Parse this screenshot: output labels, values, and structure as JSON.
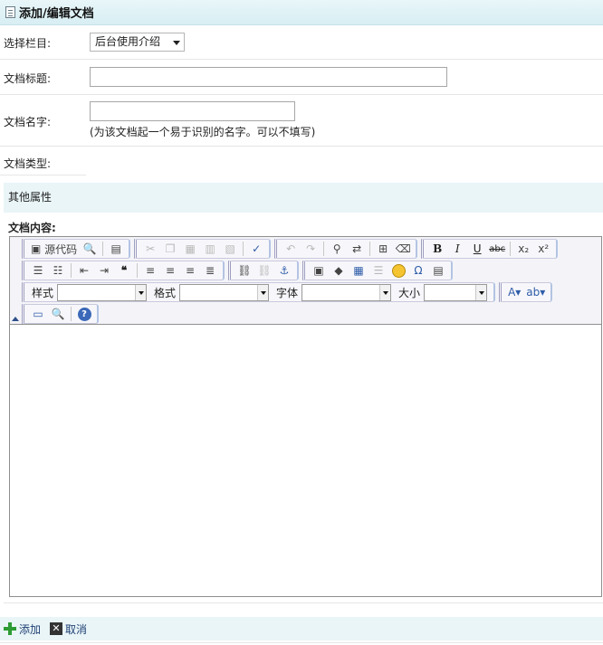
{
  "header": {
    "title": "添加/编辑文档",
    "icon": "document-edit-icon"
  },
  "form": {
    "section_label": "选择栏目:",
    "section_value": "后台使用介绍",
    "title_label": "文档标题:",
    "title_value": "",
    "name_label": "文档名字:",
    "name_value": "",
    "name_hint": "(为该文档起一个易于识别的名字。可以不填写)",
    "type_label": "文档类型:",
    "type_value": ""
  },
  "other_attributes": "其他属性",
  "content_label": "文档内容:",
  "editor": {
    "source_label": "源代码",
    "style_label": "样式",
    "format_label": "格式",
    "font_label": "字体",
    "size_label": "大小",
    "style_value": "",
    "format_value": "",
    "font_value": "",
    "size_value": "",
    "body": ""
  },
  "actions": {
    "add_label": "添加",
    "cancel_label": "取消"
  },
  "colors": {
    "header_bg": "#d7eef3",
    "section_bg": "#e9f5f7",
    "add_icon": "#2e9b35",
    "link_text": "#1f3f74"
  }
}
